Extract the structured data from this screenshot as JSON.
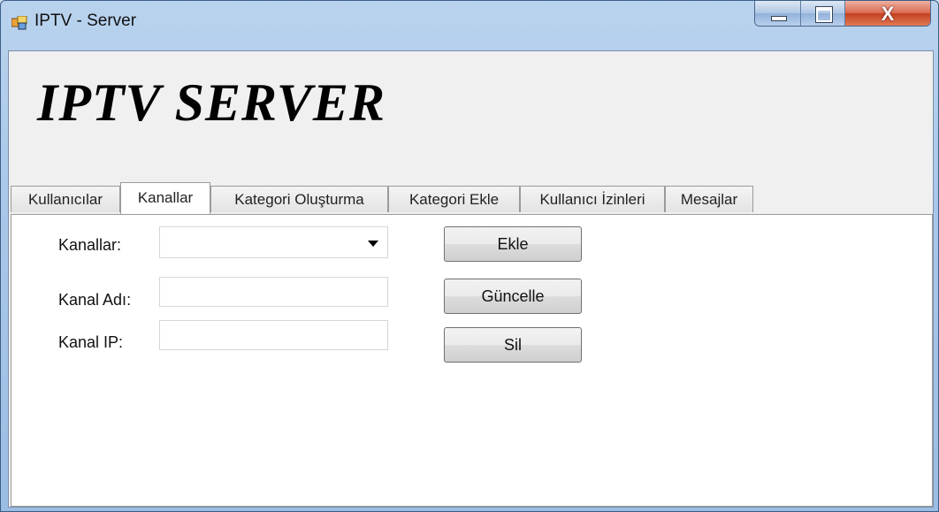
{
  "window": {
    "title": "IPTV - Server",
    "icon": "windows-form-icon"
  },
  "caption": {
    "minimize": "minimize-icon",
    "maximize": "maximize-icon",
    "close": "X"
  },
  "header": {
    "title": "IPTV SERVER"
  },
  "tabs": [
    {
      "label": "Kullanıcılar",
      "active": false
    },
    {
      "label": "Kanallar",
      "active": true
    },
    {
      "label": "Kategori Oluşturma",
      "active": false
    },
    {
      "label": "Kategori Ekle",
      "active": false
    },
    {
      "label": "Kullanıcı İzinleri",
      "active": false
    },
    {
      "label": "Mesajlar",
      "active": false
    }
  ],
  "form": {
    "channels_label": "Kanallar:",
    "channels_value": "",
    "name_label": "Kanal Adı:",
    "name_value": "",
    "ip_label": "Kanal IP:",
    "ip_value": ""
  },
  "buttons": {
    "add": "Ekle",
    "update": "Güncelle",
    "delete": "Sil"
  },
  "colors": {
    "accent_frame": "#a9c7e9",
    "close_red": "#c4401f",
    "panel_bg": "#f0f0f0"
  }
}
